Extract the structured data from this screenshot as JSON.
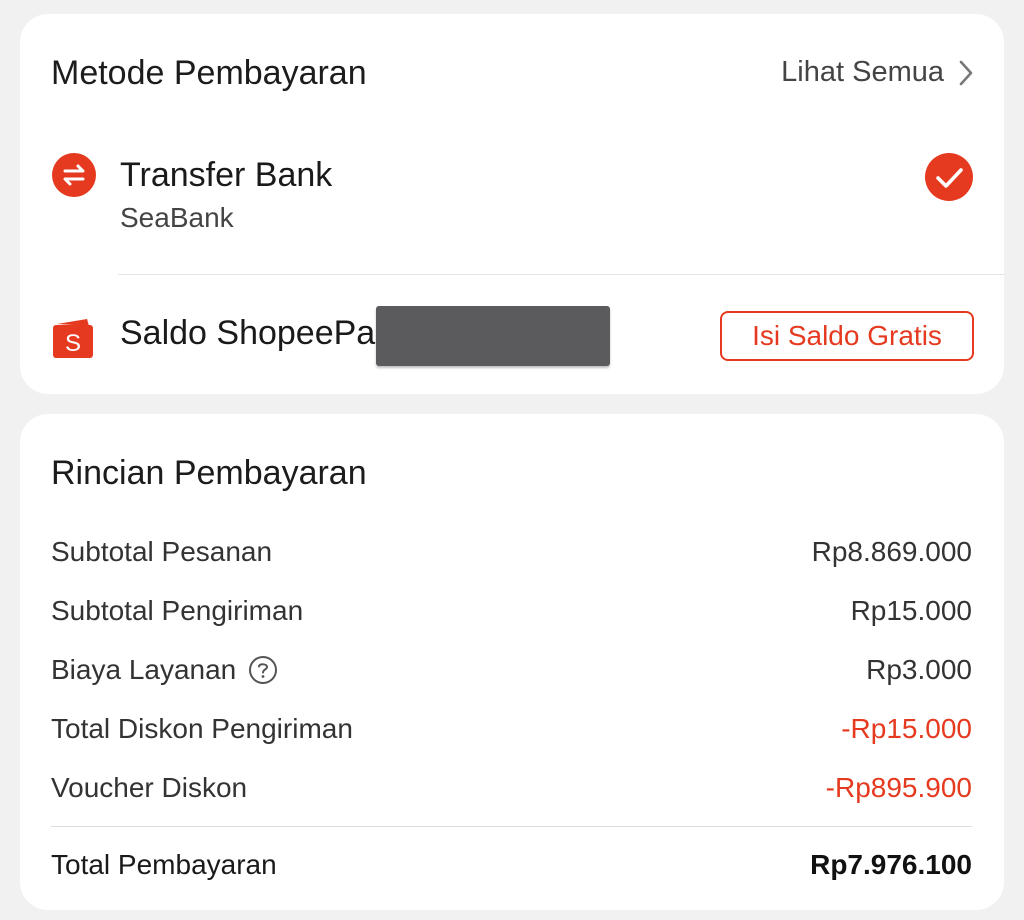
{
  "payment_methods": {
    "title": "Metode Pembayaran",
    "see_all_label": "Lihat Semua",
    "transfer_bank": {
      "name": "Transfer Bank",
      "sub": "SeaBank",
      "selected": true
    },
    "shopeepay": {
      "name": "Saldo ShopeePa",
      "topup_label": "Isi Saldo Gratis"
    }
  },
  "payment_details": {
    "title": "Rincian Pembayaran",
    "rows": [
      {
        "label": "Subtotal Pesanan",
        "value": "Rp8.869.000"
      },
      {
        "label": "Subtotal Pengiriman",
        "value": "Rp15.000"
      },
      {
        "label": "Biaya Layanan",
        "value": "Rp3.000"
      },
      {
        "label": "Total Diskon Pengiriman",
        "value": "-Rp15.000"
      },
      {
        "label": "Voucher Diskon",
        "value": "-Rp895.900"
      }
    ],
    "total": {
      "label": "Total Pembayaran",
      "value": "Rp7.976.100"
    }
  },
  "colors": {
    "accent": "#e53a1f",
    "background": "#f1f1f1",
    "card": "#ffffff"
  },
  "icons": {
    "transfer": "transfer-arrows-icon",
    "selected": "check-circle-icon",
    "shopeepay": "shopeepay-wallet-icon",
    "chevron": "chevron-right-icon",
    "help": "question-circle-icon"
  }
}
